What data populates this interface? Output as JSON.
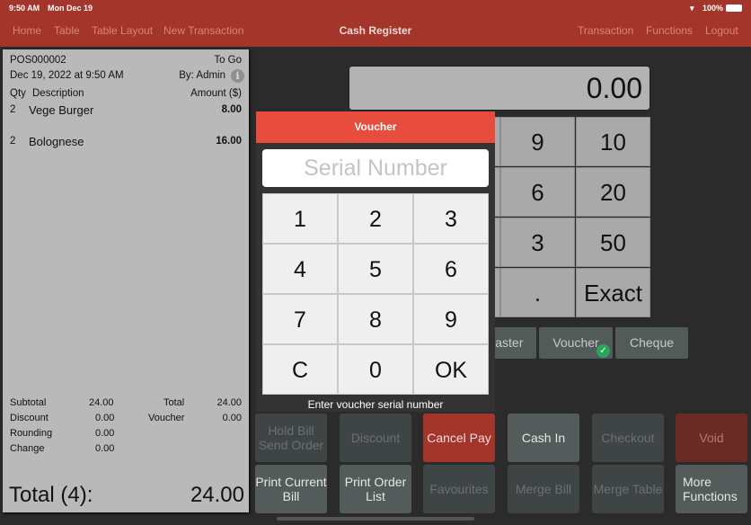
{
  "status_bar": {
    "time": "9:50 AM",
    "date": "Mon Dec 19",
    "battery": "100%"
  },
  "nav": {
    "left": [
      "Home",
      "Table",
      "Table Layout",
      "New Transaction"
    ],
    "title": "Cash Register",
    "right": [
      "Transaction",
      "Functions",
      "Logout"
    ]
  },
  "receipt": {
    "number": "POS000002",
    "order_type": "To Go",
    "datetime": "Dec 19, 2022 at 9:50 AM",
    "by": "By: Admin",
    "headers": {
      "qty": "Qty",
      "description": "Description",
      "amount": "Amount ($)"
    },
    "items": [
      {
        "qty": "2",
        "description": "Vege Burger",
        "amount": "8.00"
      },
      {
        "qty": "2",
        "description": "Bolognese",
        "amount": "16.00"
      }
    ],
    "summary": {
      "subtotal_label": "Subtotal",
      "subtotal": "24.00",
      "total_label": "Total",
      "total": "24.00",
      "discount_label": "Discount",
      "discount": "0.00",
      "voucher_label": "Voucher",
      "voucher": "0.00",
      "rounding_label": "Rounding",
      "rounding": "0.00",
      "change_label": "Change",
      "change": "0.00"
    },
    "grand_total_label": "Total (4):",
    "grand_total": "24.00"
  },
  "display": {
    "amount": "0.00"
  },
  "payment_keypad": {
    "col1": [
      "9",
      "6",
      "3",
      "."
    ],
    "col2": [
      "10",
      "20",
      "50",
      "Exact"
    ]
  },
  "payment_methods": [
    {
      "label": "Master",
      "selected": false
    },
    {
      "label": "Voucher",
      "selected": true
    },
    {
      "label": "Cheque",
      "selected": false
    }
  ],
  "voucher_popup": {
    "title": "Voucher",
    "placeholder": "Serial Number",
    "value": "",
    "keys": [
      "1",
      "2",
      "3",
      "4",
      "5",
      "6",
      "7",
      "8",
      "9",
      "C",
      "0",
      "OK"
    ],
    "hint": "Enter voucher serial number"
  },
  "functions": [
    {
      "label": "Hold Bill Send Order",
      "state": "disabled"
    },
    {
      "label": "Discount",
      "state": "disabled"
    },
    {
      "label": "Cancel Pay",
      "state": "red"
    },
    {
      "label": "Cash In",
      "state": "enabled"
    },
    {
      "label": "Checkout",
      "state": "disabled"
    },
    {
      "label": "Void",
      "state": "darkred"
    },
    {
      "label": "Print Current Bill",
      "state": "enabled"
    },
    {
      "label": "Print Order List",
      "state": "enabled"
    },
    {
      "label": "Favourites",
      "state": "disabled"
    },
    {
      "label": "Merge Bill",
      "state": "disabled"
    },
    {
      "label": "Merge Table",
      "state": "disabled"
    },
    {
      "label": "More Functions",
      "state": "enabled"
    }
  ],
  "colors": {
    "brand": "#a3352b",
    "popup_header": "#e74c3c",
    "check": "#27a55a"
  }
}
